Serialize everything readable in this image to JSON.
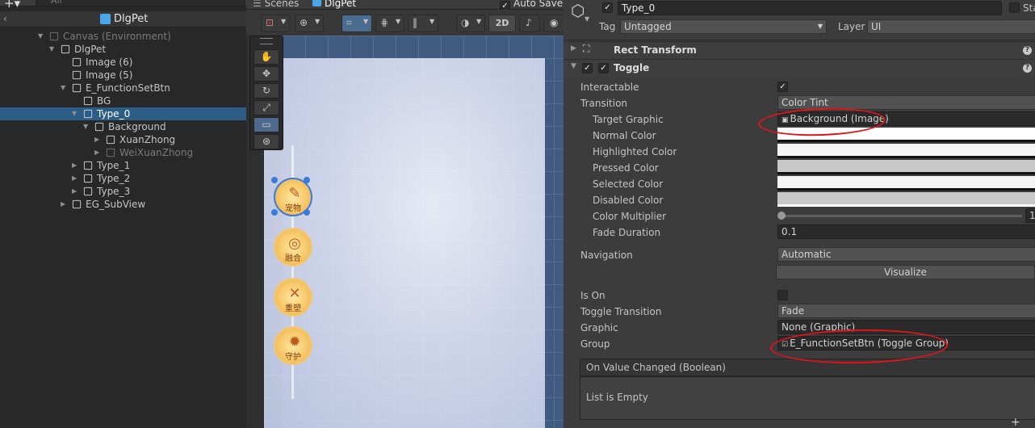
{
  "hierarchy": {
    "search_placeholder": "All",
    "scene_name": "DlgPet",
    "items": [
      {
        "label": "Canvas (Environment)",
        "depth": 0
      },
      {
        "label": "DlgPet",
        "depth": 1
      },
      {
        "label": "Image (6)",
        "depth": 2
      },
      {
        "label": "Image (5)",
        "depth": 2
      },
      {
        "label": "E_FunctionSetBtn",
        "depth": 2
      },
      {
        "label": "BG",
        "depth": 3
      },
      {
        "label": "Type_0",
        "depth": 3
      },
      {
        "label": "Background",
        "depth": 4
      },
      {
        "label": "XuanZhong",
        "depth": 5
      },
      {
        "label": "WeiXuanZhong",
        "depth": 5
      },
      {
        "label": "Type_1",
        "depth": 3
      },
      {
        "label": "Type_2",
        "depth": 3
      },
      {
        "label": "Type_3",
        "depth": 3
      },
      {
        "label": "EG_SubView",
        "depth": 2
      }
    ]
  },
  "scene": {
    "tab_label": "Scenes",
    "breadcrumb": "DlgPet",
    "auto_save": "Auto Save",
    "mode_2d": "2D",
    "buttons": [
      {
        "label": "宠物"
      },
      {
        "label": "融合"
      },
      {
        "label": "重塑"
      },
      {
        "label": "守护"
      }
    ]
  },
  "inspector": {
    "object_name": "Type_0",
    "static_label": "Sta",
    "tag_label": "Tag",
    "tag_value": "Untagged",
    "layer_label": "Layer",
    "layer_value": "UI",
    "rect_transform": "Rect Transform",
    "toggle": "Toggle",
    "interactable": "Interactable",
    "transition": "Transition",
    "transition_value": "Color Tint",
    "target_graphic": "Target Graphic",
    "target_graphic_value": "Background (Image)",
    "normal_color": "Normal Color",
    "highlighted_color": "Highlighted Color",
    "pressed_color": "Pressed Color",
    "selected_color": "Selected Color",
    "disabled_color": "Disabled Color",
    "color_multiplier": "Color Multiplier",
    "color_multiplier_value": "1",
    "fade_duration": "Fade Duration",
    "fade_duration_value": "0.1",
    "navigation": "Navigation",
    "navigation_value": "Automatic",
    "visualize": "Visualize",
    "is_on": "Is On",
    "toggle_transition": "Toggle Transition",
    "toggle_transition_value": "Fade",
    "graphic": "Graphic",
    "graphic_value": "None (Graphic)",
    "group": "Group",
    "group_value": "E_FunctionSetBtn (Toggle Group)",
    "on_value_changed": "On Value Changed (Boolean)",
    "list_empty": "List is Empty"
  }
}
